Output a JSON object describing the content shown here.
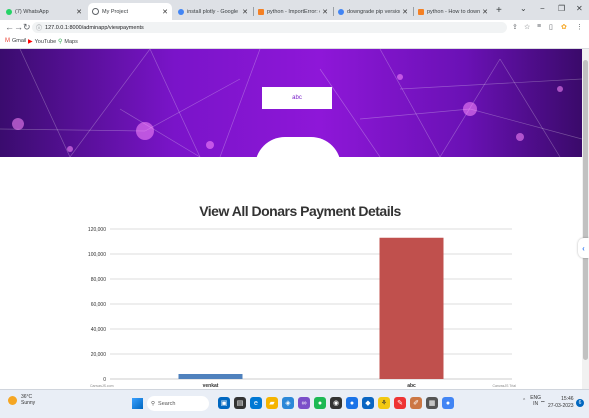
{
  "browser": {
    "tabs": [
      {
        "title": "(7) WhatsApp",
        "color": "#25d366"
      },
      {
        "title": "My Project",
        "color": "#5f6368"
      },
      {
        "title": "install plotly - Google Sea",
        "color": "#4285f4"
      },
      {
        "title": "python - ImportError: can",
        "color": "#f48024"
      },
      {
        "title": "downgrade pip version - G",
        "color": "#4285f4"
      },
      {
        "title": "python - How to downgrad",
        "color": "#f48024"
      }
    ],
    "active_tab_index": 1,
    "new_tab_label": "+",
    "url": "127.0.0.1:8000/adminapp/viewpayments",
    "window_controls": {
      "chevron": "⌄",
      "minimize": "−",
      "restore": "❐",
      "close": "✕"
    },
    "bookmarks": [
      {
        "label": "Gmail",
        "icon": "gmail-icon"
      },
      {
        "label": "YouTube",
        "icon": "youtube-icon"
      },
      {
        "label": "Maps",
        "icon": "maps-icon"
      }
    ]
  },
  "page": {
    "name_box_text": "abc",
    "accent": "#8e17d8"
  },
  "chart_data": {
    "type": "bar",
    "title": "View All Donars Payment Details",
    "categories": [
      "venkat",
      "abc"
    ],
    "values": [
      4000,
      113000
    ],
    "colors": [
      "#4f81bd",
      "#c0504d"
    ],
    "ylim": [
      0,
      120000
    ],
    "yticks": [
      "0",
      "20,000",
      "40,000",
      "60,000",
      "80,000",
      "100,000",
      "120,000"
    ],
    "ytick_values": [
      0,
      20000,
      40000,
      60000,
      80000,
      100000,
      120000
    ],
    "grid": true,
    "credit_left": "CanvasJS.com",
    "credit_right": "CanvasJS Trial"
  },
  "taskbar": {
    "weather_temp": "36°C",
    "weather_desc": "Sunny",
    "search_label": "Search",
    "tray_lang": "ENG",
    "tray_region": "IN",
    "time": "15:46",
    "date": "27-03-2023",
    "notification_count": "6"
  }
}
